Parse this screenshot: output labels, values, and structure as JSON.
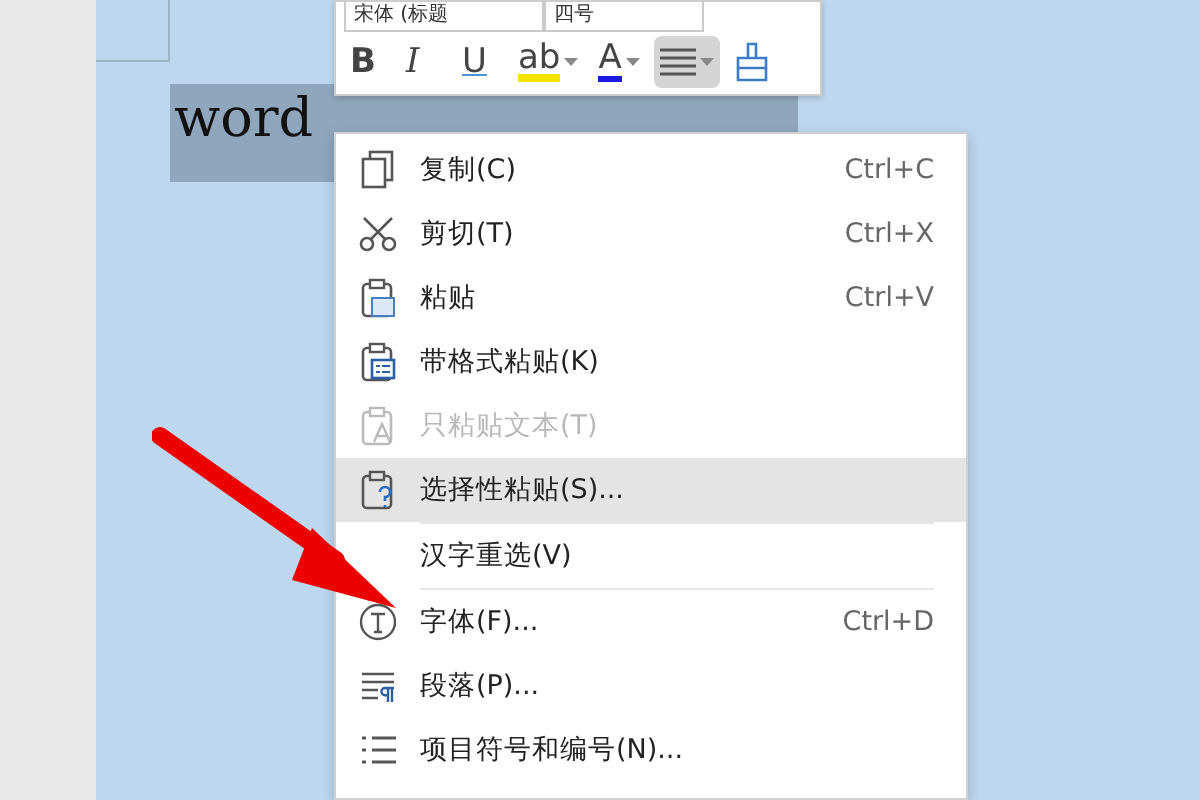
{
  "document": {
    "selected_text": "word"
  },
  "mini_toolbar": {
    "font_name": "宋体 (标题",
    "font_size": "四号",
    "buttons": [
      {
        "kind": "bold",
        "label": "B",
        "active": false
      },
      {
        "kind": "italic",
        "label": "I",
        "active": false
      },
      {
        "kind": "underline",
        "label": "U",
        "active": false
      },
      {
        "kind": "highlight",
        "label": "ab",
        "active": false
      },
      {
        "kind": "fontcolor",
        "label": "A",
        "active": false
      },
      {
        "kind": "align",
        "active": true
      },
      {
        "kind": "painter",
        "active": false
      }
    ]
  },
  "context_menu": {
    "items": [
      {
        "kind": "item",
        "label": "复制(C)",
        "shortcut": "Ctrl+C",
        "disabled": false,
        "highlighted": false
      },
      {
        "kind": "item",
        "label": "剪切(T)",
        "shortcut": "Ctrl+X",
        "disabled": false,
        "highlighted": false
      },
      {
        "kind": "item",
        "label": "粘贴",
        "shortcut": "Ctrl+V",
        "disabled": false,
        "highlighted": false
      },
      {
        "kind": "item",
        "label": "带格式粘贴(K)",
        "disabled": false,
        "highlighted": false
      },
      {
        "kind": "item",
        "label": "只粘贴文本(T)",
        "disabled": true,
        "highlighted": false
      },
      {
        "kind": "item",
        "label": "选择性粘贴(S)...",
        "disabled": false,
        "highlighted": true
      },
      {
        "kind": "separator"
      },
      {
        "kind": "item",
        "label": "汉字重选(V)",
        "disabled": false,
        "highlighted": false
      },
      {
        "kind": "separator"
      },
      {
        "kind": "item",
        "label": "字体(F)...",
        "shortcut": "Ctrl+D",
        "disabled": false,
        "highlighted": false
      },
      {
        "kind": "item",
        "label": "段落(P)...",
        "disabled": false,
        "highlighted": false
      },
      {
        "kind": "item",
        "label": "项目符号和编号(N)...",
        "disabled": false,
        "highlighted": false
      }
    ]
  }
}
